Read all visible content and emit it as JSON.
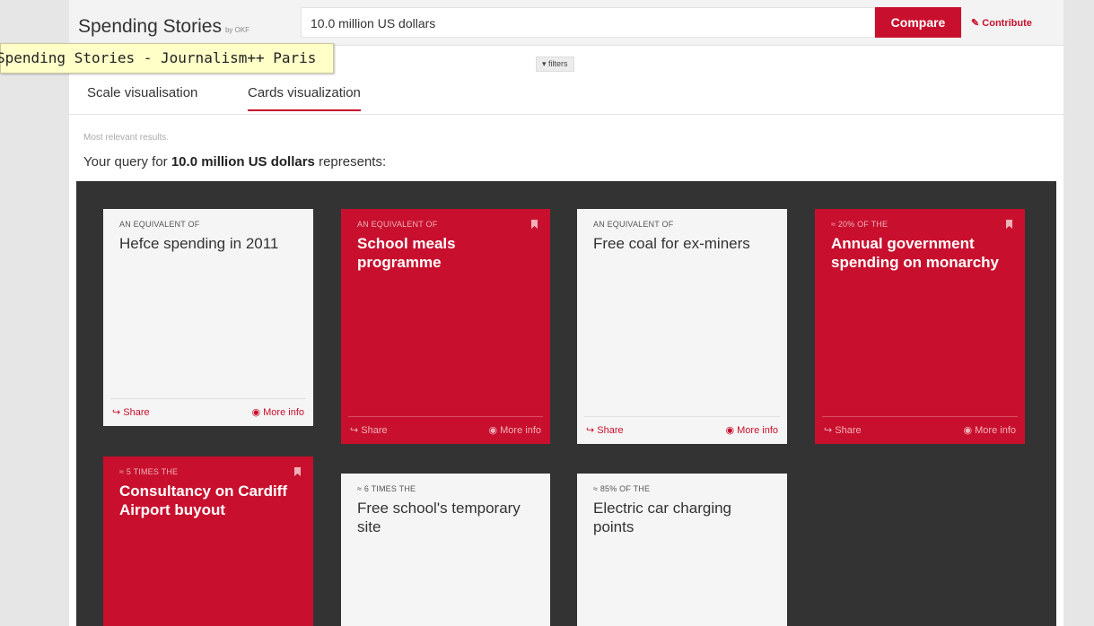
{
  "header": {
    "brand_title": "Spending Stories",
    "brand_by": "by OKF",
    "search_value": "10.0 million US dollars",
    "compare_label": "Compare",
    "contribute_label": "Contribute"
  },
  "tooltip": "Spending Stories - Journalism++ Paris",
  "filters_label": "filters",
  "tabs": [
    {
      "label": "Scale visualisation"
    },
    {
      "label": "Cards visualization"
    }
  ],
  "results": {
    "relevance_note": "Most relevant results.",
    "query_prefix": "Your query for",
    "query_value": "10.0 million US dollars",
    "query_suffix": "represents:"
  },
  "colors": {
    "accent": "#c8102e",
    "grid_bg": "#333333"
  },
  "cards": [
    {
      "kicker": "AN EQUIVALENT OF",
      "title": "Hefce spending in 2011",
      "style": "white",
      "share": "Share",
      "more": "More info"
    },
    {
      "kicker": "AN EQUIVALENT OF",
      "title": "School meals programme",
      "style": "red",
      "share": "Share",
      "more": "More info"
    },
    {
      "kicker": "AN EQUIVALENT OF",
      "title": "Free coal for ex-miners",
      "style": "white",
      "share": "Share",
      "more": "More info"
    },
    {
      "kicker": "≈ 20% OF THE",
      "title": "Annual government spending on monarchy",
      "style": "red",
      "share": "Share",
      "more": "More info"
    },
    {
      "kicker": "≈ 5 TIMES THE",
      "title": "Consultancy on Cardiff Airport buyout",
      "style": "red"
    },
    {
      "kicker": "≈ 6 TIMES THE",
      "title": "Free school's temporary site",
      "style": "white"
    },
    {
      "kicker": "≈ 85% OF THE",
      "title": "Electric car charging points",
      "style": "white"
    }
  ]
}
